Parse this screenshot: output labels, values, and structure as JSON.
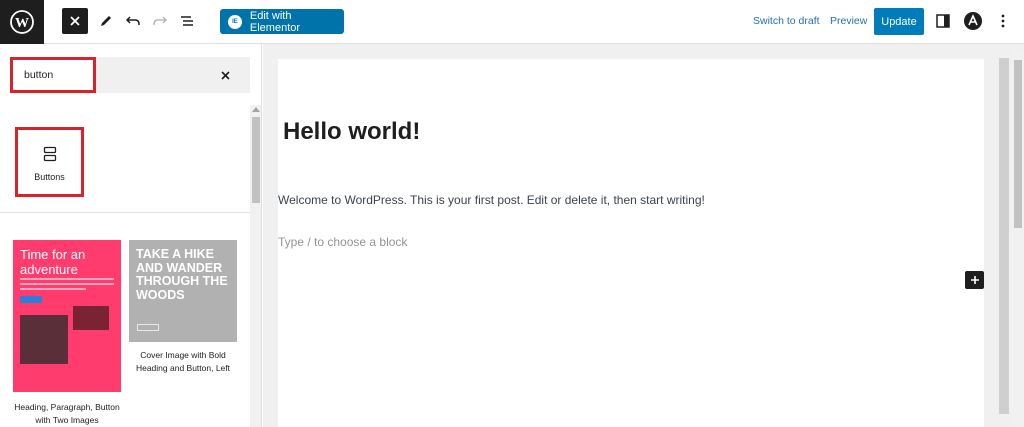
{
  "topbar": {
    "elementor_label": "Edit with Elementor",
    "switch_to_draft": "Switch to draft",
    "preview": "Preview",
    "update": "Update"
  },
  "inserter": {
    "search_value": "button",
    "block_label": "Buttons",
    "patterns": [
      {
        "caption": "Heading, Paragraph, Button with Two Images",
        "preview_title": "Time for an adventure"
      },
      {
        "caption": "Cover Image with Bold Heading and Button, Left",
        "preview_title": "TAKE A HIKE AND WANDER THROUGH THE WOODS"
      }
    ]
  },
  "editor": {
    "title": "Hello world!",
    "paragraph": "Welcome to WordPress. This is your first post. Edit or delete it, then start writing!",
    "placeholder": "Type / to choose a block"
  },
  "colors": {
    "accent": "#007cba",
    "elementor": "#0073aa",
    "highlight": "#d6242c",
    "pattern_pink": "#ff3c6d"
  }
}
